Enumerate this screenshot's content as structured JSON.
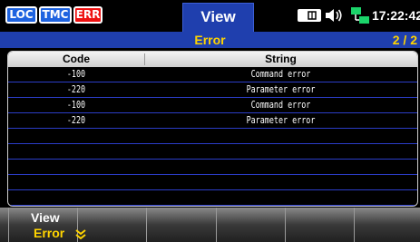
{
  "status": {
    "loc": "LOC",
    "tmc": "TMC",
    "err": "ERR",
    "view_tab": "View",
    "icons": [
      "memory-icon",
      "speaker-icon",
      "lan-icon"
    ],
    "time": "17:22:42"
  },
  "title": {
    "label": "Error",
    "page": "2 / 2"
  },
  "table": {
    "columns": [
      "Code",
      "String"
    ],
    "rows": [
      {
        "code": "-100",
        "string": "Command error"
      },
      {
        "code": "-220",
        "string": "Parameter error"
      },
      {
        "code": "-100",
        "string": "Command error"
      },
      {
        "code": "-220",
        "string": "Parameter error"
      }
    ]
  },
  "softkeys": {
    "view": {
      "title": "View",
      "value": "Error"
    }
  },
  "colors": {
    "accent_blue": "#1f3fae",
    "highlight_yellow": "#ffd400",
    "error_red": "#e11111",
    "badge_blue": "#1e63e0"
  }
}
